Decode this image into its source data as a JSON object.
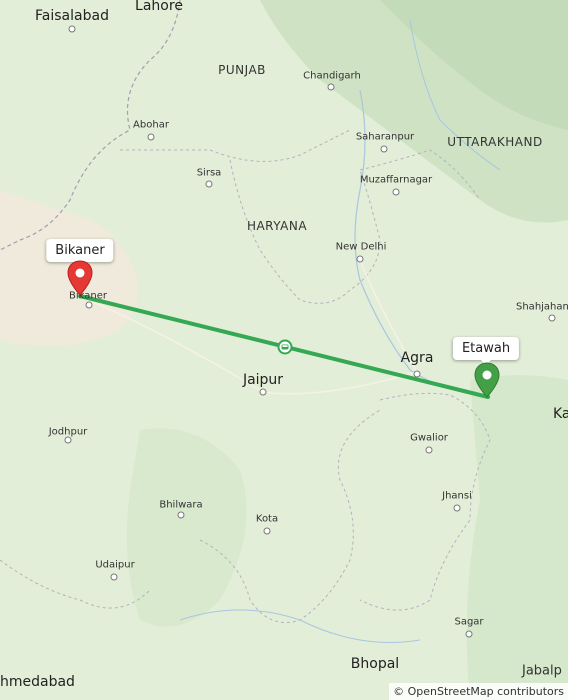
{
  "map": {
    "route_color": "#34a853",
    "regions": {
      "punjab": "PUNJAB",
      "haryana": "HARYANA",
      "uttarakhand": "UTTARAKHAND"
    },
    "cities": {
      "lahore": "Lahore",
      "faisalabad": "Faisalabad",
      "chandigarh": "Chandigarh",
      "abohar": "Abohar",
      "saharanpur": "Saharanpur",
      "sirsa": "Sirsa",
      "muzaffarnagar": "Muzaffarnagar",
      "new_delhi": "New Delhi",
      "bikaner": "Bikaner",
      "shahjahanpur": "Shahjahan",
      "agra": "Agra",
      "jaipur": "Jaipur",
      "jodhpur": "Jodhpur",
      "gwalior": "Gwalior",
      "kanpur": "Ka",
      "jhansi": "Jhansi",
      "bhilwara": "Bhilwara",
      "kota": "Kota",
      "udaipur": "Udaipur",
      "sagar": "Sagar",
      "bhopal": "Bhopal",
      "ahmedabad": "hmedabad",
      "jabalpur": "Jabalp"
    },
    "markers": {
      "origin": {
        "label": "Bikaner",
        "color": "#e53935"
      },
      "destination": {
        "label": "Etawah",
        "color": "#43a047"
      }
    },
    "midpoint_icon": "car-icon",
    "attribution": "© OpenStreetMap contributors"
  }
}
